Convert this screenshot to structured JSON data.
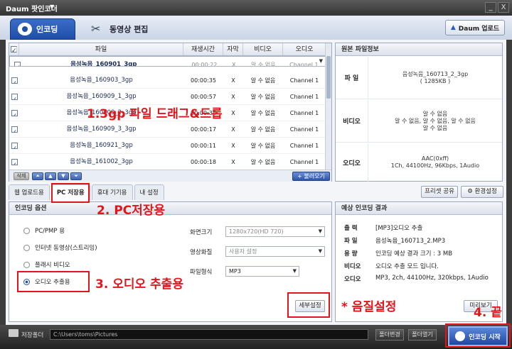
{
  "window": {
    "title": "Daum 팟인코더",
    "title_arrow": "▼",
    "min": "_",
    "close": "X"
  },
  "tabs": {
    "encoding": "인코딩",
    "video_edit": "동영상 편집",
    "daum_upload": "Daum 업로드"
  },
  "file_table": {
    "columns": [
      "파일",
      "재생시간",
      "자막",
      "비디오",
      "오디오"
    ],
    "rows": [
      {
        "name": "음성녹음_160901_3gp",
        "duration": "00:00:22",
        "sub": "X",
        "video": "알 수 없음",
        "audio": "Channel 1",
        "selected": true
      },
      {
        "name": "음성녹음_160903_3gp",
        "duration": "00:00:35",
        "sub": "X",
        "video": "알 수 없음",
        "audio": "Channel 1",
        "selected": false
      },
      {
        "name": "음성녹음_160909_1_3gp",
        "duration": "00:00:57",
        "sub": "X",
        "video": "알 수 없음",
        "audio": "Channel 1",
        "selected": false
      },
      {
        "name": "음성녹음_160909_2_3gp",
        "duration": "00:00:34",
        "sub": "X",
        "video": "알 수 없음",
        "audio": "Channel 1",
        "selected": false
      },
      {
        "name": "음성녹음_160909_3_3gp",
        "duration": "00:00:17",
        "sub": "X",
        "video": "알 수 없음",
        "audio": "Channel 1",
        "selected": false
      },
      {
        "name": "음성녹음_160921_3gp",
        "duration": "00:00:11",
        "sub": "X",
        "video": "알 수 없음",
        "audio": "Channel 1",
        "selected": false
      },
      {
        "name": "음성녹음_161002_3gp",
        "duration": "00:00:18",
        "sub": "X",
        "video": "알 수 없음",
        "audio": "Channel 1",
        "selected": false
      }
    ],
    "delete": "삭제",
    "add_file": "불러오기"
  },
  "source_info": {
    "title": "원본 파일정보",
    "file_label": "파 일",
    "file_name": "음성녹음_160713_2_3gp",
    "file_size": "( 1285KB )",
    "video_label": "비디오",
    "video_line1": "알 수 없음",
    "video_line2": "알 수 없음, 알 수 없음, 알 수 없음",
    "video_line3": "알 수 없음",
    "audio_label": "오디오",
    "audio_line1": "AAC(0xff)",
    "audio_line2": "1Ch, 44100Hz, 96Kbps, 1Audio"
  },
  "sub_tabs": [
    "웹 업로드용",
    "PC 저장용",
    "휴대 기기용",
    "내 설정"
  ],
  "preset_share": "프리셋 공유",
  "env_settings": "환경설정",
  "options": {
    "title": "인코딩 옵션",
    "radios": [
      "PC/PMP 용",
      "인터넷 동영상(스트리밍)",
      "플래시 비디오",
      "오디오 추출용"
    ],
    "screen_label": "화면크기",
    "screen_value": "1280x720(HD 720)",
    "quality_label": "영상화질",
    "quality_value": "사용자 설정",
    "format_label": "파일형식",
    "format_value": "MP3",
    "detail_button": "세부설정"
  },
  "result": {
    "title": "예상 인코딩 결과",
    "rows": [
      {
        "k": "출 력",
        "v": "[MP3]오디오 추출"
      },
      {
        "k": "파 일",
        "v": "음성녹음_160713_2.MP3"
      },
      {
        "k": "용 량",
        "v": "인코딩 예상 결과 크기 : 3 MB"
      },
      {
        "k": "비디오",
        "v": "오디오 추출 모드 입니다."
      },
      {
        "k": "오디오",
        "v": "MP3, 2ch, 44100Hz, 320kbps, 1Audio"
      }
    ],
    "preview": "미리보기"
  },
  "footer": {
    "save_folder": "저장폴더",
    "path": "C:\\Users\\toms\\Pictures",
    "change_folder": "폴더변경",
    "open_folder": "폴더열기",
    "start": "인코딩 시작"
  },
  "annotations": {
    "step1": "1.3gp 파일 드래그&드롭",
    "step2": "2. PC저장용",
    "step3": "3. 오디오 추출용",
    "step_note": "* 음질설정",
    "step4": "4. 끝"
  }
}
